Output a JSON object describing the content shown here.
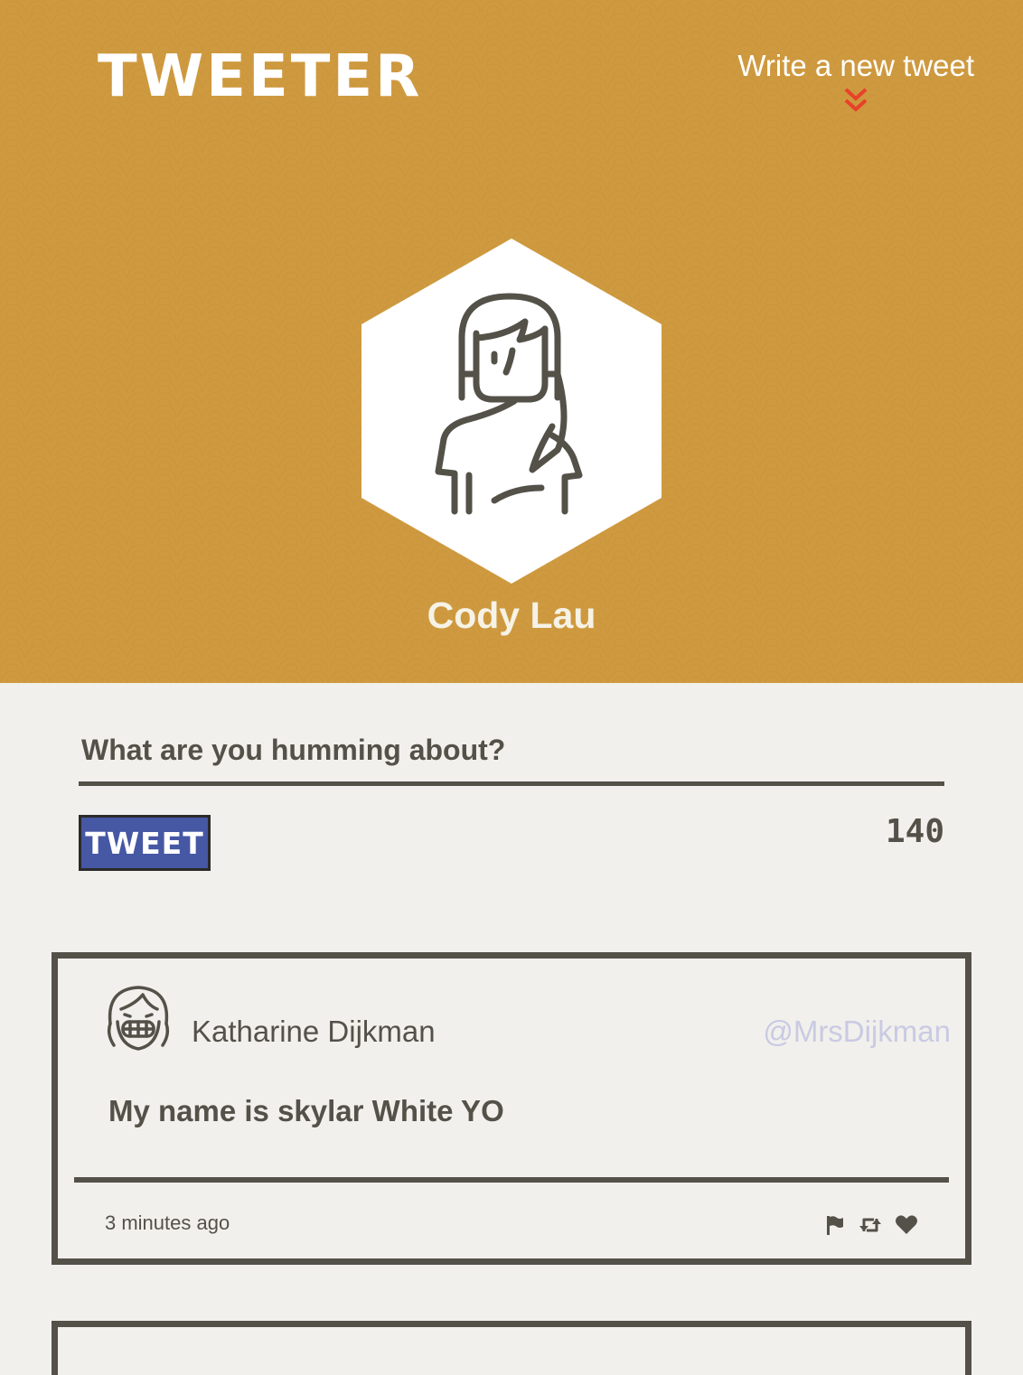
{
  "header": {
    "logo": "TWEETER",
    "compose_link": "Write a new tweet",
    "user_name": "Cody Lau"
  },
  "compose": {
    "placeholder": "What are you humming about?",
    "button_label": "TWEET",
    "char_count": "140"
  },
  "tweets": [
    {
      "author": "Katharine Dijkman",
      "handle": "@MrsDijkman",
      "body": "My name is skylar White YO",
      "time": "3 minutes ago",
      "actions": [
        "flag-icon",
        "retweet-icon",
        "heart-icon"
      ]
    }
  ],
  "colors": {
    "header_bg": "#cf9a3f",
    "page_bg": "#f1f0ec",
    "text_dark": "#545149",
    "button_bg": "#4657a3",
    "handle": "#c9cae3",
    "accent_red": "#e8412b"
  }
}
